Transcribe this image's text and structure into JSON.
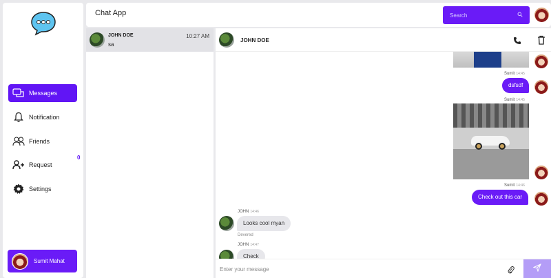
{
  "app": {
    "title": "Chat App"
  },
  "search": {
    "placeholder": "Search"
  },
  "sidebar": {
    "items": [
      {
        "label": "Messages",
        "icon": "messages-icon",
        "active": true
      },
      {
        "label": "Notification",
        "icon": "bell-icon"
      },
      {
        "label": "Friends",
        "icon": "friends-icon"
      },
      {
        "label": "Request",
        "icon": "add-user-icon"
      },
      {
        "label": "Settings",
        "icon": "gear-icon"
      }
    ],
    "request_count": "0",
    "user": {
      "name": "Sumit Mahat"
    }
  },
  "chat_list": [
    {
      "name": "JOHN DOE",
      "last_message": "sa",
      "time": "10:27 AM"
    }
  ],
  "conversation": {
    "contact_name": "JOHN DOE",
    "messages": [
      {
        "sender": "Sumit",
        "time": "14:45",
        "text": "dsfsdf"
      },
      {
        "sender": "Sumit",
        "time": "14:45",
        "type": "image",
        "alt": "car"
      },
      {
        "sender": "Sumit",
        "time": "14:46",
        "text": "Check out this car"
      },
      {
        "sender": "JOHN",
        "time": "14:46",
        "text": "Looks cool myan",
        "status": "Devered"
      },
      {
        "sender": "JOHN",
        "time": "14:47",
        "text": "Check"
      }
    ],
    "composer_placeholder": "Enter your message"
  },
  "colors": {
    "accent": "#6a1bf7",
    "accent_light": "#b49df7"
  }
}
